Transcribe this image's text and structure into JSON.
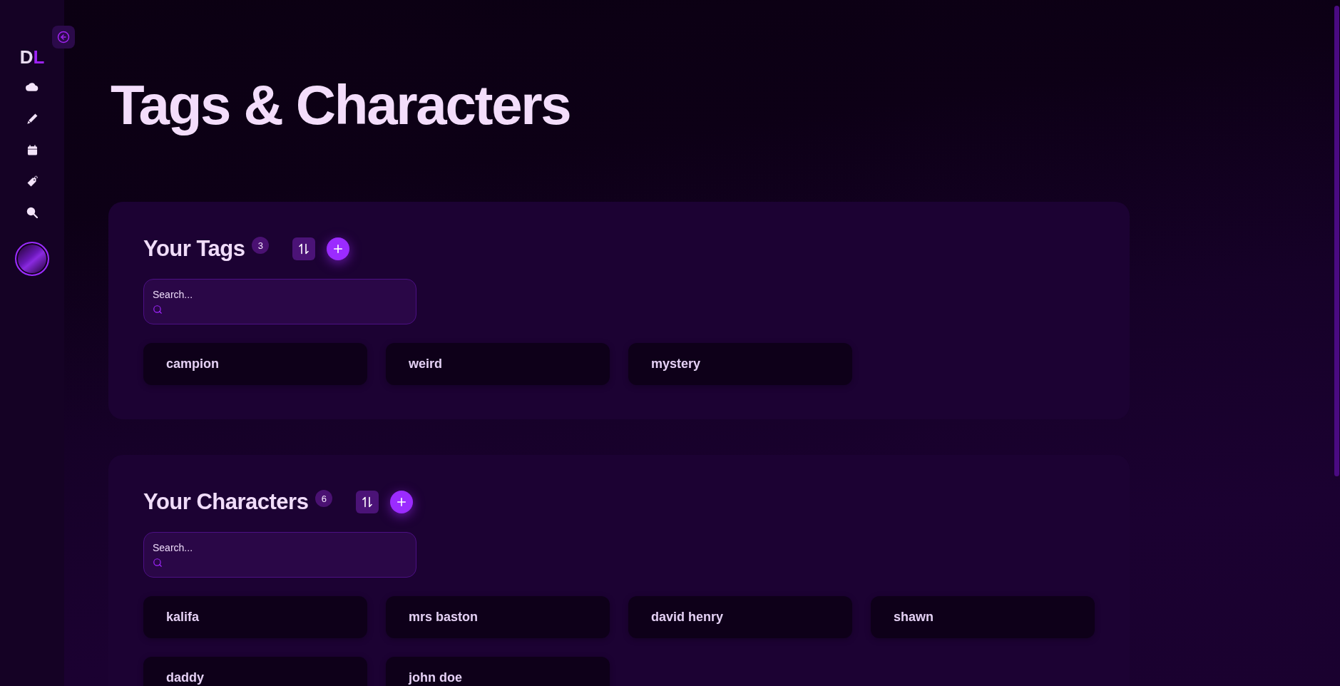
{
  "sidebar": {
    "logo": {
      "primary": "D",
      "accent": "L"
    }
  },
  "page": {
    "title": "Tags & Characters"
  },
  "sections": [
    {
      "title": "Your Tags",
      "count": "3",
      "search": {
        "placeholder": "Search..."
      },
      "items": [
        {
          "name": "campion"
        },
        {
          "name": "weird"
        },
        {
          "name": "mystery"
        }
      ]
    },
    {
      "title": "Your Characters",
      "count": "6",
      "search": {
        "placeholder": "Search..."
      },
      "items": [
        {
          "name": "kalifa"
        },
        {
          "name": "mrs baston"
        },
        {
          "name": "david henry"
        },
        {
          "name": "shawn"
        },
        {
          "name": "daddy"
        },
        {
          "name": "john doe"
        }
      ]
    }
  ]
}
